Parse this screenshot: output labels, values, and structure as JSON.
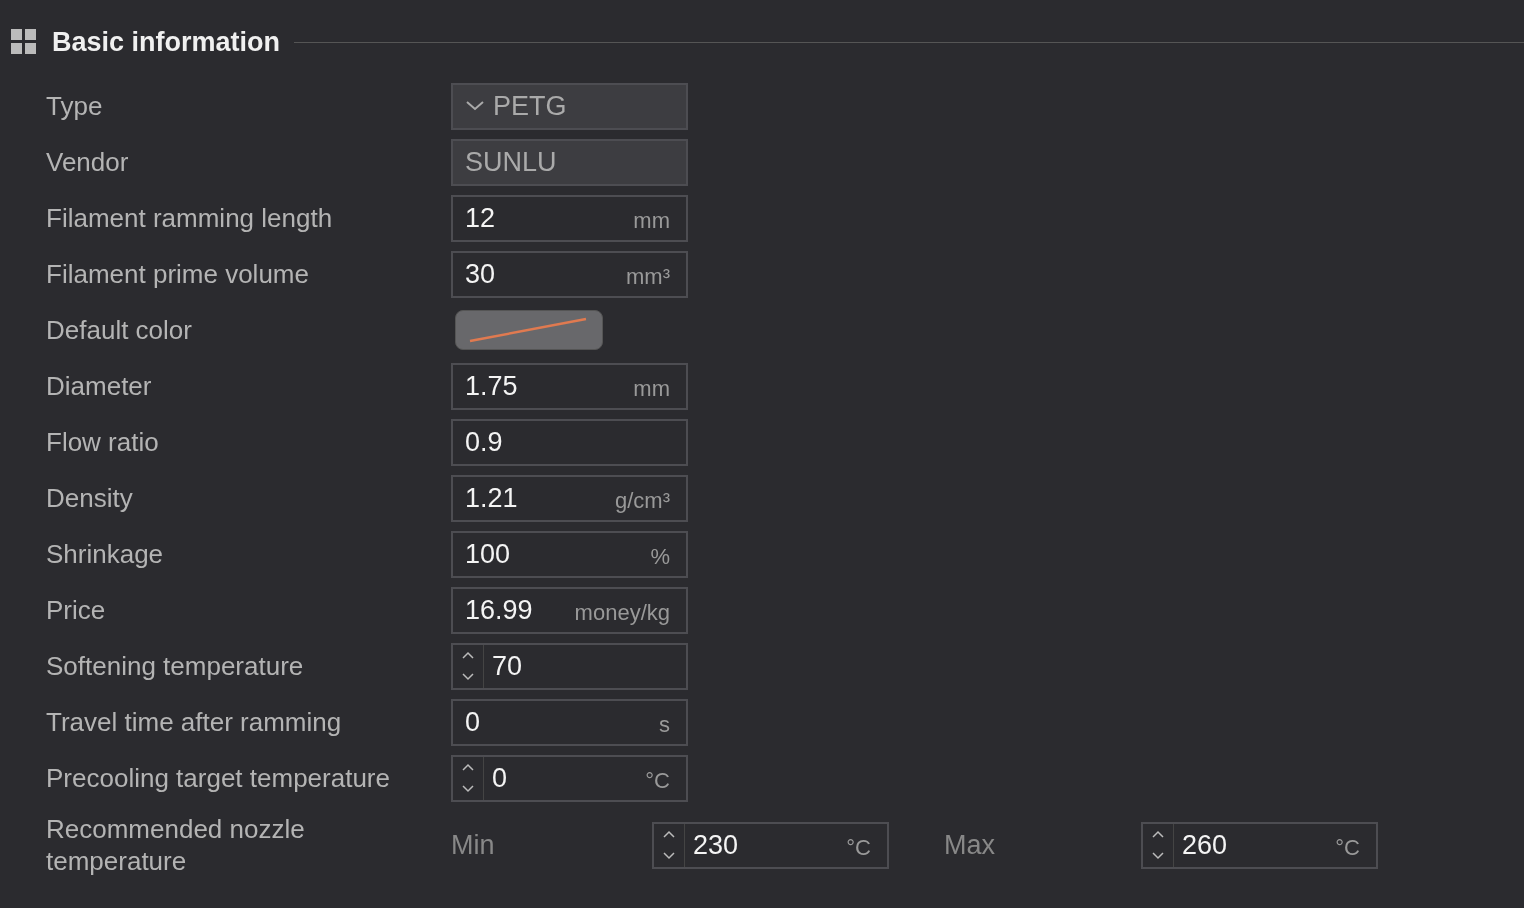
{
  "section": {
    "title": "Basic information"
  },
  "rows": [
    {
      "kind": "dropdown",
      "label": "Type",
      "value": "PETG",
      "disabled": true
    },
    {
      "kind": "text",
      "label": "Vendor",
      "value": "SUNLU",
      "disabled": true
    },
    {
      "kind": "text",
      "label": "Filament ramming length",
      "value": "12",
      "unit": "mm",
      "disabled": false
    },
    {
      "kind": "text",
      "label": "Filament prime volume",
      "value": "30",
      "unit": "mm³",
      "disabled": false
    },
    {
      "kind": "color",
      "label": "Default color"
    },
    {
      "kind": "text",
      "label": "Diameter",
      "value": "1.75",
      "unit": "mm",
      "disabled": false
    },
    {
      "kind": "text",
      "label": "Flow ratio",
      "value": "0.9",
      "disabled": false
    },
    {
      "kind": "text",
      "label": "Density",
      "value": "1.21",
      "unit": "g/cm³",
      "disabled": false
    },
    {
      "kind": "text",
      "label": "Shrinkage",
      "value": "100",
      "unit": "%",
      "disabled": false
    },
    {
      "kind": "text",
      "label": "Price",
      "value": "16.99",
      "unit": "money/kg",
      "disabled": false
    },
    {
      "kind": "spin",
      "label": "Softening temperature",
      "value": "70"
    },
    {
      "kind": "text",
      "label": "Travel time after ramming",
      "value": "0",
      "unit": "s",
      "disabled": false
    },
    {
      "kind": "spin",
      "label": "Precooling target temperature",
      "value": "0",
      "unit": "°C"
    },
    {
      "kind": "range",
      "label": "Recommended nozzle temperature",
      "min_label": "Min",
      "min": {
        "value": "230",
        "unit": "°C"
      },
      "max_label": "Max",
      "max": {
        "value": "260",
        "unit": "°C"
      }
    }
  ]
}
